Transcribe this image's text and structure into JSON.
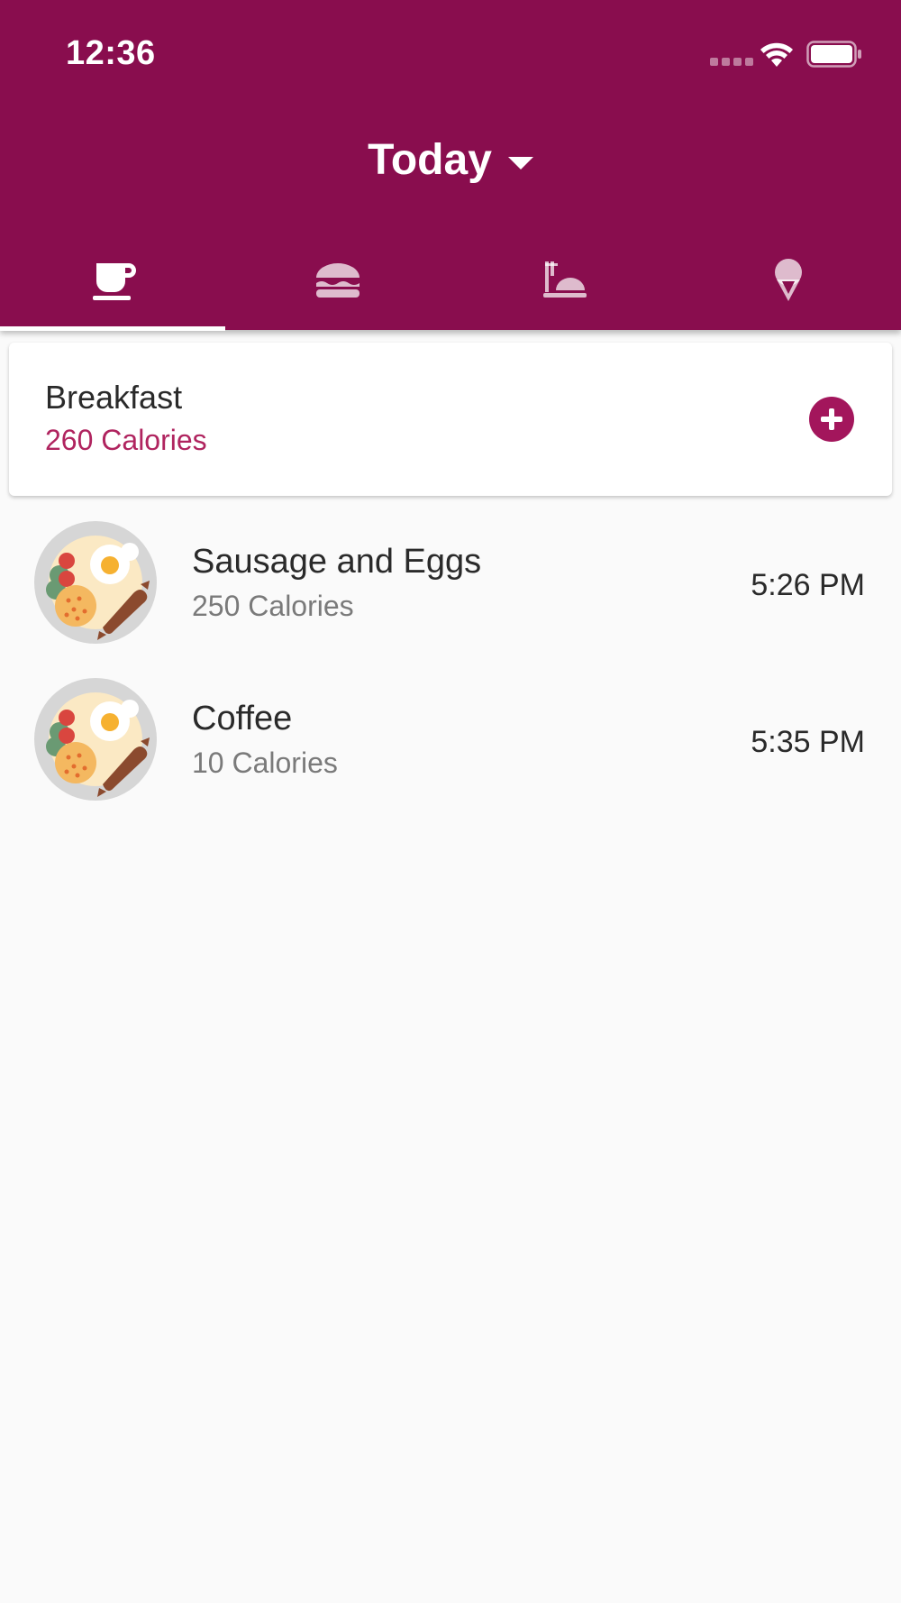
{
  "status_bar": {
    "time": "12:36"
  },
  "app_bar": {
    "title": "Today",
    "tabs": [
      {
        "name": "breakfast",
        "icon": "coffee-cup-icon",
        "selected": true
      },
      {
        "name": "lunch",
        "icon": "burger-icon",
        "selected": false
      },
      {
        "name": "dinner",
        "icon": "dinner-plate-icon",
        "selected": false
      },
      {
        "name": "snack",
        "icon": "ice-cream-icon",
        "selected": false
      }
    ]
  },
  "meal": {
    "name": "Breakfast",
    "calories": "260 Calories"
  },
  "entries": [
    {
      "name": "Sausage and Eggs",
      "calories": "250 Calories",
      "time": "5:26 PM",
      "image_icon": "breakfast-plate-icon"
    },
    {
      "name": "Coffee",
      "calories": "10 Calories",
      "time": "5:35 PM",
      "image_icon": "breakfast-plate-icon"
    }
  ],
  "colors": {
    "primary": "#890d4e",
    "accent": "#a3165c",
    "calorie_text": "#b0245f",
    "background": "#fafafa"
  }
}
